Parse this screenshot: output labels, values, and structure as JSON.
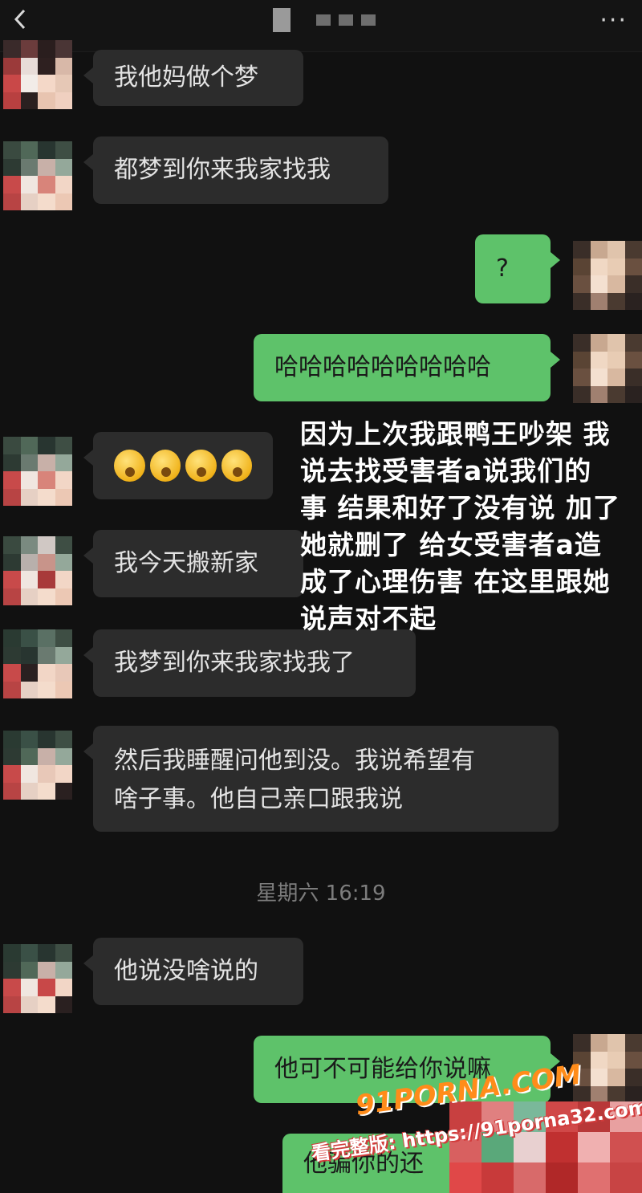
{
  "header": {
    "back_icon": "back-arrow-icon",
    "more_icon": "···"
  },
  "messages": [
    {
      "side": "in",
      "text": "我他妈做个梦"
    },
    {
      "side": "in",
      "text": "都梦到你来我家找我"
    },
    {
      "side": "out",
      "text": "?"
    },
    {
      "side": "out",
      "text": "哈哈哈哈哈哈哈哈哈"
    },
    {
      "side": "in",
      "text": "",
      "emoji": [
        "sleepy-face",
        "sleepy-face",
        "sleepy-face",
        "sleepy-face"
      ]
    },
    {
      "side": "in",
      "text": "我今天搬新家"
    },
    {
      "side": "in",
      "text": "我梦到你来我家找我了"
    },
    {
      "side": "in",
      "text": "然后我睡醒问他到没。我说希望有",
      "text2": "啥子事。他自己亲口跟我说"
    },
    {
      "side": "in",
      "text": "他说没啥说的"
    },
    {
      "side": "out",
      "text": "他可不可能给你说嘛"
    },
    {
      "side": "out",
      "text": "他骗你的还"
    }
  ],
  "timestamp": "星期六 16:19",
  "overlay_text": "因为上次我跟鸭王吵架 我\n说去找受害者a说我们的\n事 结果和好了没有说 加了\n她就删了 给女受害者a造\n成了心理伤害 在这里跟她\n说声对不起",
  "watermark": {
    "logo": "91PORNA.COM",
    "url": "看完整版: https://91porna32.com"
  },
  "colors": {
    "background": "#111111",
    "incoming_bubble": "#2c2c2c",
    "outgoing_bubble": "#5ec26a",
    "timestamp": "#7d7d7d"
  }
}
